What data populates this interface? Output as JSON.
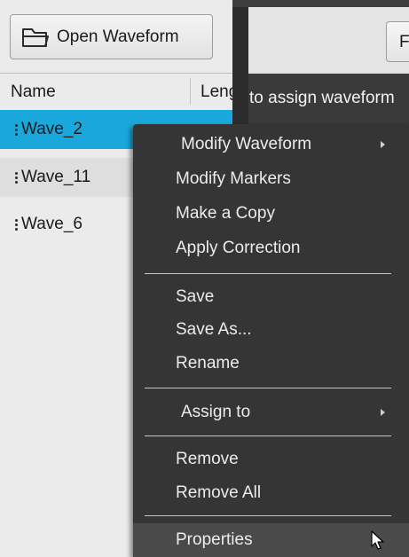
{
  "toolbar": {
    "open_waveform_label": "Open Waveform",
    "f_button_label": "F"
  },
  "list": {
    "col_name": "Name",
    "col_length": "Leng",
    "items": [
      "Wave_2",
      "Wave_11",
      "Wave_6"
    ]
  },
  "hint": "to assign waveform",
  "menu": {
    "items": [
      {
        "label": "Modify Waveform",
        "submenu": true
      },
      {
        "label": "Modify Markers"
      },
      {
        "label": "Make a Copy"
      },
      {
        "label": "Apply Correction"
      },
      {
        "label": "Save"
      },
      {
        "label": "Save As..."
      },
      {
        "label": "Rename"
      },
      {
        "label": "Assign to",
        "submenu": true
      },
      {
        "label": "Remove"
      },
      {
        "label": "Remove All"
      },
      {
        "label": "Properties"
      }
    ]
  },
  "colors": {
    "selection": "#1aa8dc",
    "menu_bg": "#353535",
    "panel_bg": "#ebebeb"
  },
  "icons": [
    "folder-icon",
    "drag-grip-icon",
    "submenu-arrow-icon",
    "mouse-cursor-icon"
  ]
}
